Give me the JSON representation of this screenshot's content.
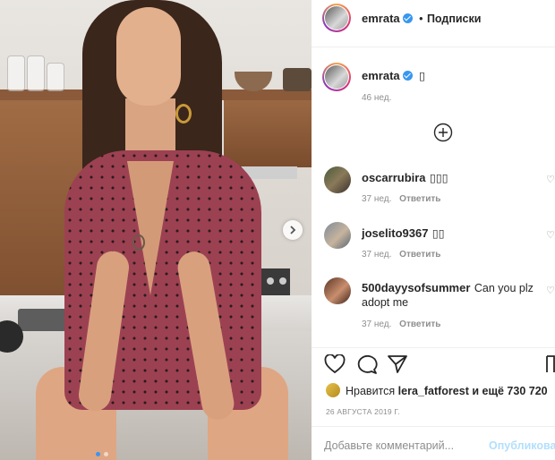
{
  "header": {
    "username": "emrata",
    "separator": "•",
    "follow_label": "Подписки"
  },
  "caption": {
    "username": "emrata",
    "text": "▯",
    "time": "46 нед."
  },
  "load_more_icon": "plus-circle-icon",
  "comments": [
    {
      "username": "oscarrubira",
      "text": "▯▯▯",
      "time": "37 нед.",
      "reply_label": "Ответить"
    },
    {
      "username": "joselito9367",
      "text": "▯▯",
      "time": "37 нед.",
      "reply_label": "Ответить"
    },
    {
      "username": "500dayysofsummer",
      "text": "Can you plz adopt me",
      "time": "37 нед.",
      "reply_label": "Ответить"
    }
  ],
  "actions": {
    "like_icon": "heart-icon",
    "comment_icon": "comment-icon",
    "share_icon": "send-icon",
    "save_icon": "bookmark-icon"
  },
  "likes": {
    "prefix": "Нравится",
    "user": "lera_fatforest",
    "suffix": "и ещё 730 720"
  },
  "date": "26 АВГУСТА 2019 Г.",
  "comment_box": {
    "placeholder": "Добавьте комментарий...",
    "post_label": "Опубликовать"
  },
  "colors": {
    "accent": "#3897f0",
    "post_disabled": "#b2dffc",
    "muted": "#8e8e8e"
  }
}
